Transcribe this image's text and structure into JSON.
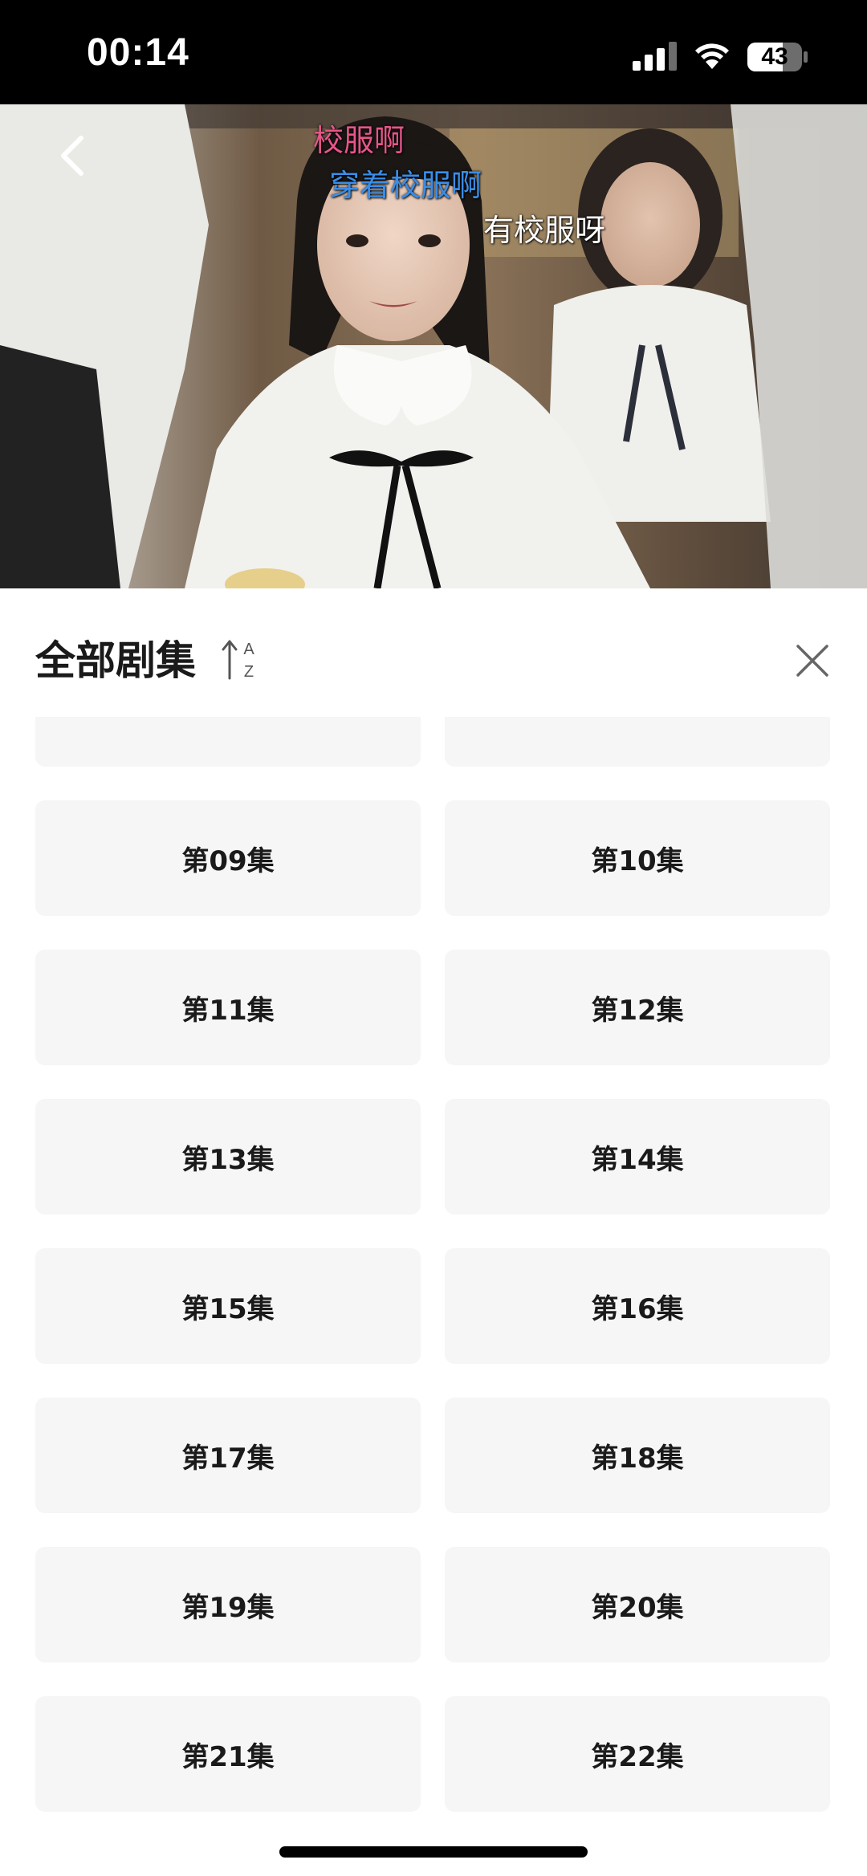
{
  "status_bar": {
    "time": "00:14",
    "battery": "43"
  },
  "video": {
    "danmaku": [
      {
        "text": "校服啊",
        "color": "#e8558a"
      },
      {
        "text": "穿着校服啊",
        "color": "#3a8ee8"
      },
      {
        "text": "有校服呀",
        "color": "#ffffff"
      }
    ]
  },
  "panel": {
    "title": "全部剧集",
    "sort_icon": "sort-az-icon",
    "close_icon": "close-icon",
    "episodes": [
      {
        "label": ""
      },
      {
        "label": ""
      },
      {
        "label": "第09集"
      },
      {
        "label": "第10集"
      },
      {
        "label": "第11集"
      },
      {
        "label": "第12集"
      },
      {
        "label": "第13集"
      },
      {
        "label": "第14集"
      },
      {
        "label": "第15集"
      },
      {
        "label": "第16集"
      },
      {
        "label": "第17集"
      },
      {
        "label": "第18集"
      },
      {
        "label": "第19集"
      },
      {
        "label": "第20集"
      },
      {
        "label": "第21集"
      },
      {
        "label": "第22集"
      }
    ]
  },
  "colors": {
    "episode_bg": "#f6f6f6",
    "episode_text": "#1a1a1a",
    "status_bar_bg": "#000000"
  }
}
